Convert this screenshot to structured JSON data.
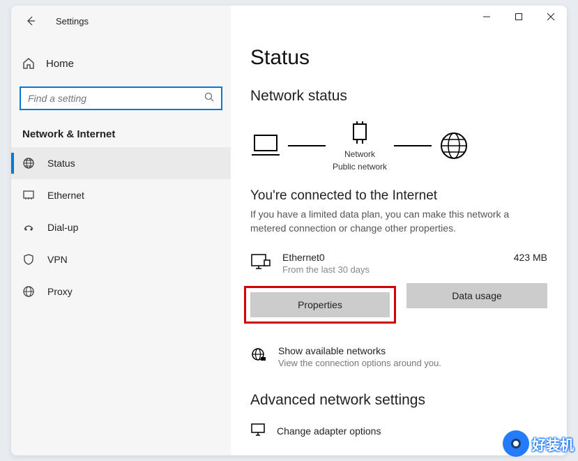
{
  "titlebar": {
    "title": "Settings"
  },
  "home": {
    "label": "Home"
  },
  "search": {
    "placeholder": "Find a setting"
  },
  "section": {
    "label": "Network & Internet"
  },
  "nav": {
    "items": [
      {
        "label": "Status"
      },
      {
        "label": "Ethernet"
      },
      {
        "label": "Dial-up"
      },
      {
        "label": "VPN"
      },
      {
        "label": "Proxy"
      }
    ]
  },
  "page": {
    "title": "Status",
    "network_status": "Network status",
    "diagram": {
      "center_label1": "Network",
      "center_label2": "Public network"
    },
    "connected_heading": "You're connected to the Internet",
    "connected_desc": "If you have a limited data plan, you can make this network a metered connection or change other properties.",
    "connection": {
      "name": "Ethernet0",
      "period": "From the last 30 days",
      "usage": "423 MB"
    },
    "buttons": {
      "properties": "Properties",
      "data_usage": "Data usage"
    },
    "available": {
      "title": "Show available networks",
      "sub": "View the connection options around you."
    },
    "advanced": "Advanced network settings",
    "adapter": "Change adapter options"
  },
  "watermark": {
    "text": "好装机"
  }
}
